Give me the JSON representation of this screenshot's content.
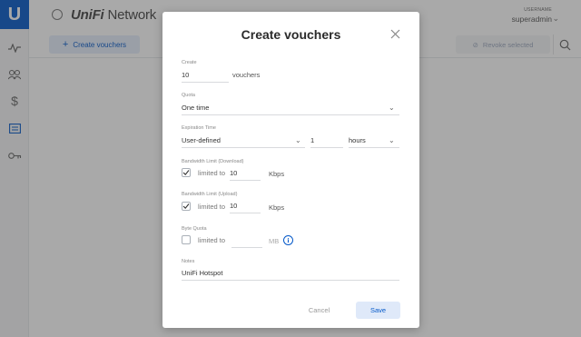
{
  "app": {
    "logo_letter": "U",
    "brand_prefix": "UniFi",
    "brand_suffix": " Network",
    "user_label": "USERNAME",
    "user_name": "superadmin"
  },
  "toolbar": {
    "create_label": "Create vouchers",
    "revoke_label": "Revoke selected"
  },
  "sidebar": {
    "items": [
      {
        "icon": "activity-icon"
      },
      {
        "icon": "clients-icon"
      },
      {
        "icon": "dollar-icon"
      },
      {
        "icon": "vouchers-icon"
      },
      {
        "icon": "key-icon"
      }
    ]
  },
  "modal": {
    "title": "Create vouchers",
    "create": {
      "label": "Create",
      "value": "10",
      "suffix": "vouchers"
    },
    "quota": {
      "label": "Quota",
      "value": "One time"
    },
    "expiration": {
      "label": "Expiration Time",
      "value": "User-defined",
      "amount": "1",
      "unit": "hours"
    },
    "bw_download": {
      "label": "Bandwidth Limit (Download)",
      "checked": true,
      "checkbox_label": "limited to",
      "value": "10",
      "unit": "Kbps"
    },
    "bw_upload": {
      "label": "Bandwidth Limit (Upload)",
      "checked": true,
      "checkbox_label": "limited to",
      "value": "10",
      "unit": "Kbps"
    },
    "byte_quota": {
      "label": "Byte Quota",
      "checked": false,
      "checkbox_label": "limited to",
      "value": "",
      "unit": "MB"
    },
    "notes": {
      "label": "Notes",
      "value": "UniFi Hotspot"
    },
    "cancel_label": "Cancel",
    "save_label": "Save"
  },
  "colors": {
    "brand_blue": "#0559c9",
    "overlay": "rgba(50,50,50,0.42)"
  }
}
